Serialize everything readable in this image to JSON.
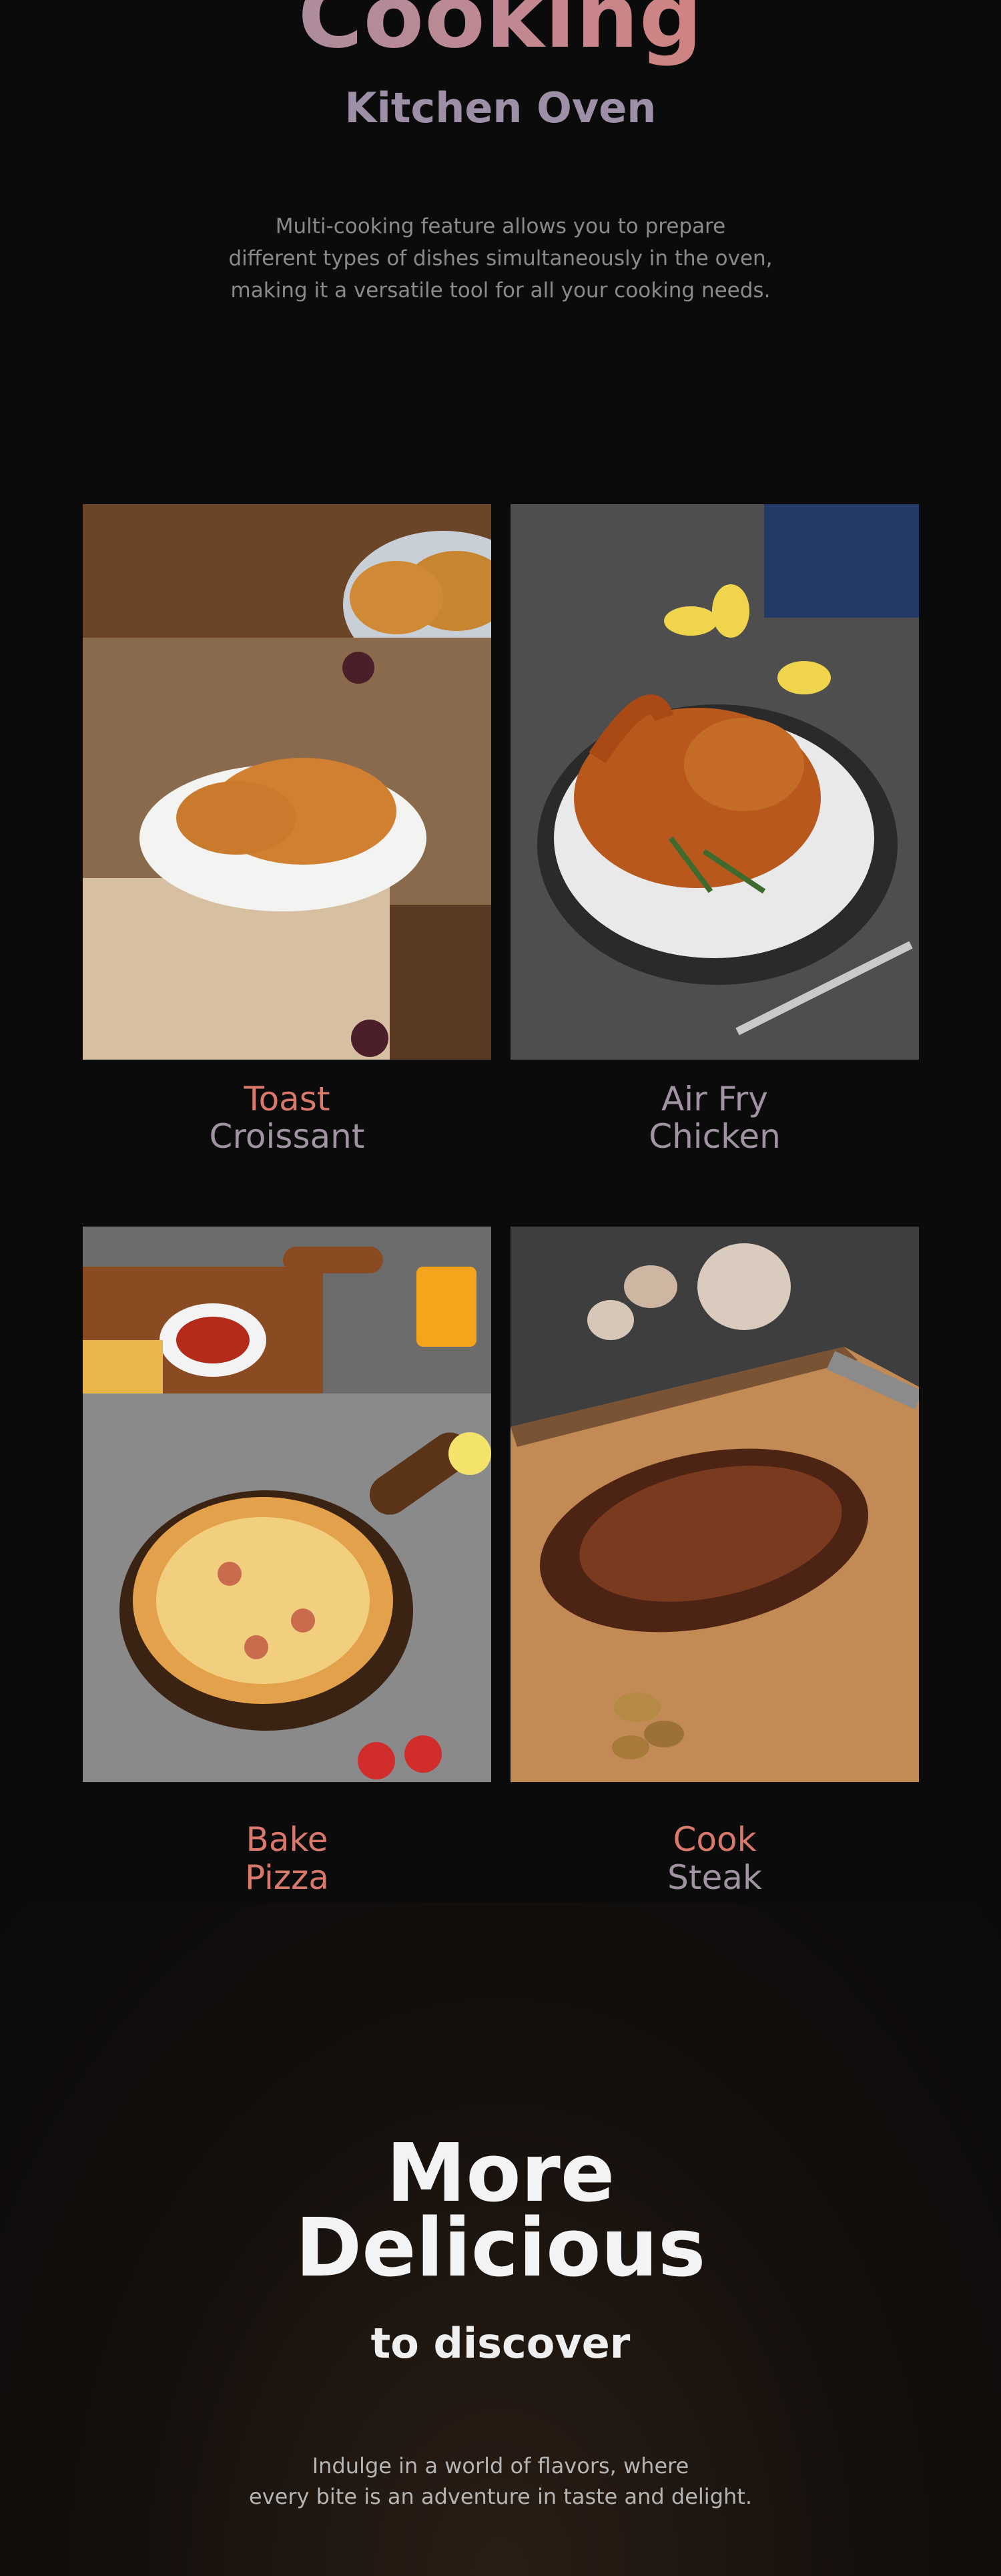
{
  "hero": {
    "title": "Cooking",
    "subtitle": "Kitchen Oven",
    "description": "Multi-cooking feature allows you to prepare\ndifferent types of dishes simultaneously in the oven,\nmaking it a versatile tool for all your cooking needs."
  },
  "dishes": [
    {
      "line1": "Toast",
      "line2": "Croissant",
      "image": "croissant-photo"
    },
    {
      "line1": "Air Fry",
      "line2": "Chicken",
      "image": "roast-chicken-photo"
    },
    {
      "line1": "Bake",
      "line2": "Pizza",
      "image": "pizza-photo"
    },
    {
      "line1": "Cook",
      "line2": "Steak",
      "image": "steak-photo"
    }
  ],
  "more": {
    "title": "More\nDelicious",
    "subtitle": "to discover",
    "description": "Indulge in a world of flavors, where\nevery bite is an adventure in taste and delight."
  },
  "colors": {
    "background": "#0b0b0b",
    "gradient_start": "#8f93ad",
    "gradient_end": "#e37b63",
    "label_accent": "#d9796c",
    "label_muted": "#a193a3"
  }
}
